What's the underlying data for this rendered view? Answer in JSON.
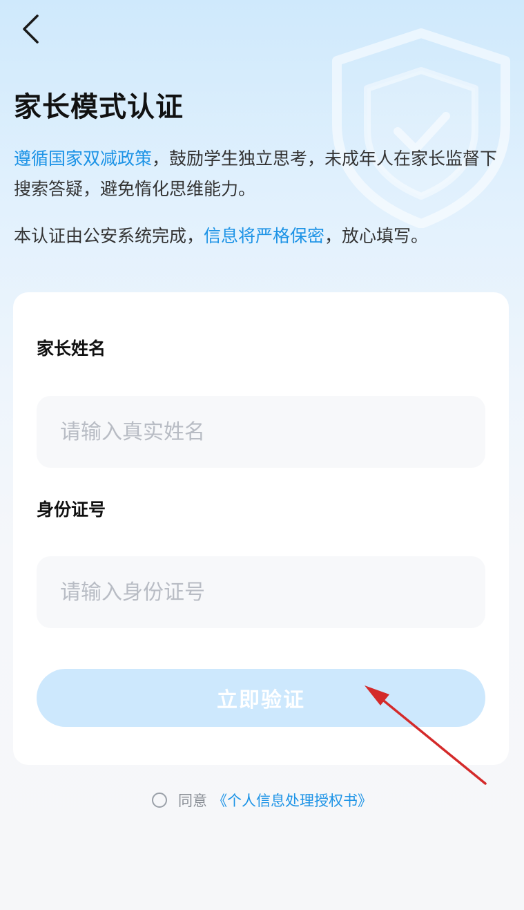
{
  "header": {
    "back_icon": "chevron-left-icon",
    "title": "家长模式认证"
  },
  "intro": {
    "line1_link": "遵循国家双减政策",
    "line1_rest": "，鼓励学生独立思考，未成年人在家长监督下搜索答疑，避免惰化思维能力。",
    "line2_prefix": "本认证由公安系统完成，",
    "line2_link": "信息将严格保密",
    "line2_suffix": "，放心填写。"
  },
  "form": {
    "name_label": "家长姓名",
    "name_placeholder": "请输入真实姓名",
    "name_value": "",
    "id_label": "身份证号",
    "id_placeholder": "请输入身份证号",
    "id_value": "",
    "submit_label": "立即验证"
  },
  "agreement": {
    "checked": false,
    "prefix": "同意",
    "link": "《个人信息处理授权书》"
  },
  "colors": {
    "accent": "#1c93e6",
    "button_disabled": "#cde8fd",
    "annotation_arrow": "#d42a2a"
  },
  "decorations": {
    "background_icon": "shield-check-icon",
    "annotation": "red-arrow-pointing-to-verify-button"
  }
}
